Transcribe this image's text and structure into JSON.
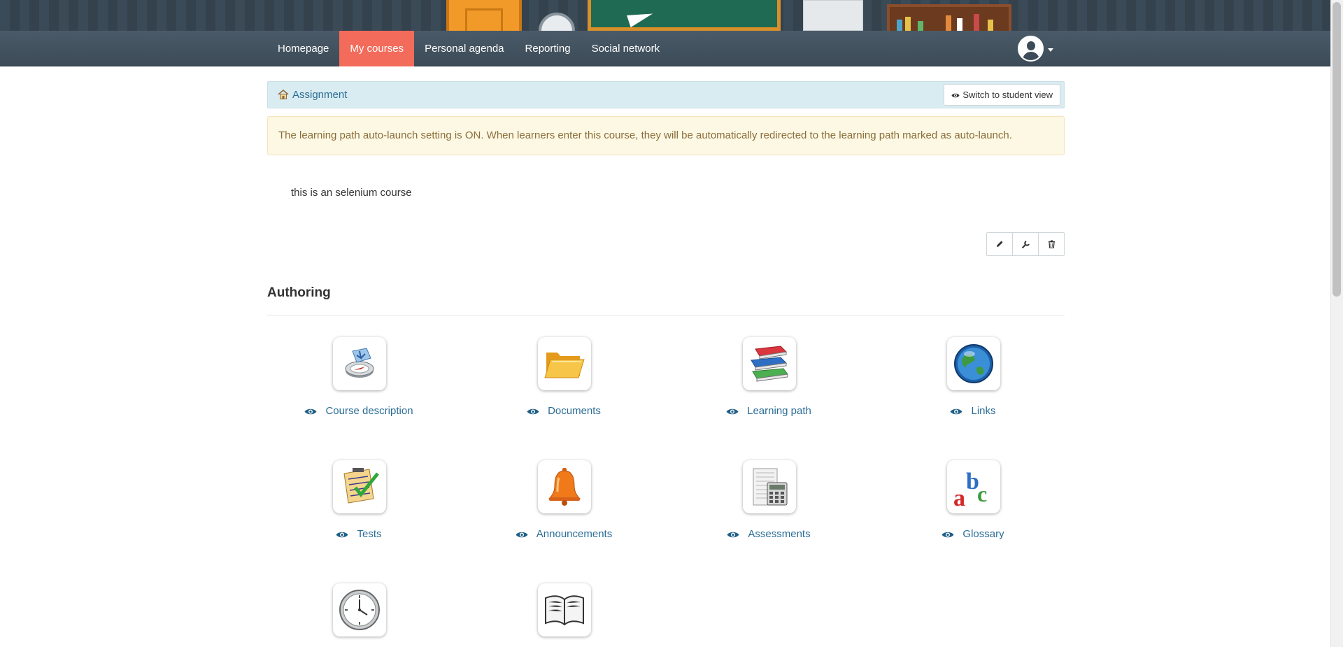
{
  "nav": {
    "items": [
      {
        "label": "Homepage",
        "active": false
      },
      {
        "label": "My courses",
        "active": true
      },
      {
        "label": "Personal agenda",
        "active": false
      },
      {
        "label": "Reporting",
        "active": false
      },
      {
        "label": "Social network",
        "active": false
      }
    ],
    "avatar_icon": "user-avatar-icon"
  },
  "breadcrumb": {
    "home_icon": "home-icon",
    "label": "Assignment",
    "switch_button": "Switch to student view"
  },
  "alert": {
    "text": "The learning path auto-launch setting is ON. When learners enter this course, they will be automatically redirected to the learning path marked as auto-launch."
  },
  "course": {
    "description": "this is an selenium course",
    "actions": [
      "pencil-icon",
      "wrench-icon",
      "trash-icon"
    ]
  },
  "section": {
    "title": "Authoring",
    "tools": [
      {
        "label": "Course description",
        "icon": "compass-icon"
      },
      {
        "label": "Documents",
        "icon": "folder-icon"
      },
      {
        "label": "Learning path",
        "icon": "books-icon"
      },
      {
        "label": "Links",
        "icon": "globe-icon"
      },
      {
        "label": "Tests",
        "icon": "checklist-icon"
      },
      {
        "label": "Announcements",
        "icon": "bell-icon"
      },
      {
        "label": "Assessments",
        "icon": "calculator-icon"
      },
      {
        "label": "Glossary",
        "icon": "abc-icon"
      },
      {
        "label": "",
        "icon": "clock-icon"
      },
      {
        "label": "",
        "icon": "open-book-icon"
      }
    ]
  },
  "colors": {
    "navbar": "#3c4b57",
    "active_nav": "#f36b5a",
    "link": "#2a6d96",
    "alert_bg": "#fcf8e3",
    "breadcrumb_bg": "#d9ecf1"
  }
}
